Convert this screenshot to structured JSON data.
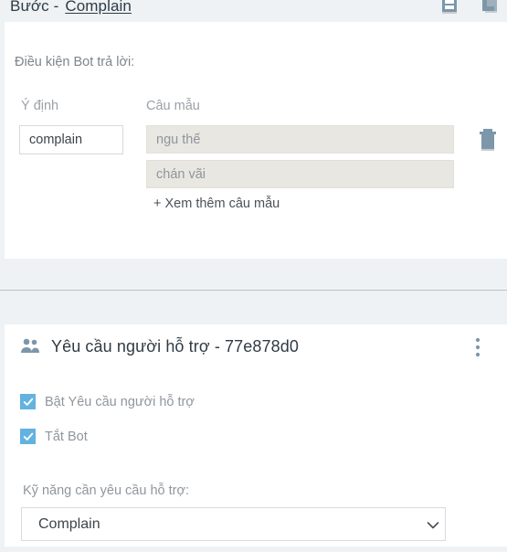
{
  "header": {
    "step_word": "Bước -",
    "step_name": "Complain",
    "icons": [
      {
        "name": "save-icon",
        "title": "Save"
      },
      {
        "name": "duplicate-icon",
        "title": "Duplicate"
      }
    ]
  },
  "condition_card": {
    "title": "Điều kiện Bot trả lời:",
    "intent_column_label": "Ý định",
    "sample_column_label": "Câu mẫu",
    "intent_value": "complain",
    "intent_placeholder": "",
    "samples": [
      {
        "value": "ngu thế",
        "placeholder": ""
      },
      {
        "value": "chán vãi",
        "placeholder": ""
      }
    ],
    "add_sample_label": "+ Xem thêm câu mẫu",
    "delete_title": "Xóa"
  },
  "handover_card": {
    "title": "Yêu cầu người hỗ trợ - 77e878d0",
    "icon": "people-icon",
    "menu_icon": "kebab-menu-icon",
    "checkboxes": [
      {
        "label": "Bật Yêu cầu người hỗ trợ",
        "checked": true
      },
      {
        "label": "Tắt Bot",
        "checked": true
      }
    ],
    "skill_label": "Kỹ năng cần yêu cầu hỗ trợ:",
    "skill_selected": "Complain",
    "skill_options": [
      "Complain"
    ]
  },
  "colors": {
    "page_background": "#eef2f5",
    "card_background": "#ffffff",
    "accent_checkbox": "#62b3e0",
    "icon_blue_grey": "#7c97aa",
    "label_grey": "#8f969d",
    "text_dark": "#303b45",
    "sample_field_fill": "#e9e7e2",
    "divider": "#b9c2c9"
  }
}
